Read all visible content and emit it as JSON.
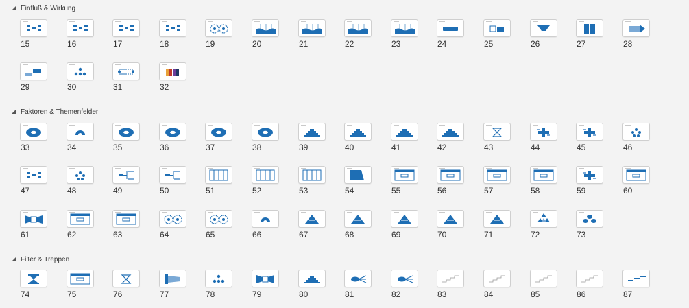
{
  "colors": {
    "accent": "#1e6eb4",
    "light": "#7aa9d6",
    "bg": "#f3f3f3"
  },
  "sections": [
    {
      "title": "Einfluß & Wirkung",
      "items": [
        {
          "n": "15",
          "t": "chart"
        },
        {
          "n": "16",
          "t": "chart"
        },
        {
          "n": "17",
          "t": "chart"
        },
        {
          "n": "18",
          "t": "chart"
        },
        {
          "n": "19",
          "t": "rings"
        },
        {
          "n": "20",
          "t": "wave"
        },
        {
          "n": "21",
          "t": "wave"
        },
        {
          "n": "22",
          "t": "wave"
        },
        {
          "n": "23",
          "t": "wave"
        },
        {
          "n": "24",
          "t": "bar"
        },
        {
          "n": "25",
          "t": "boxes"
        },
        {
          "n": "26",
          "t": "funnel"
        },
        {
          "n": "27",
          "t": "blocks"
        },
        {
          "n": "28",
          "t": "arrow"
        },
        {
          "n": "29",
          "t": "step"
        },
        {
          "n": "30",
          "t": "dots"
        },
        {
          "n": "31",
          "t": "cycle"
        },
        {
          "n": "32",
          "t": "color"
        }
      ]
    },
    {
      "title": "Faktoren & Themenfelder",
      "items": [
        {
          "n": "33",
          "t": "ellipse"
        },
        {
          "n": "34",
          "t": "semi"
        },
        {
          "n": "35",
          "t": "ellipse"
        },
        {
          "n": "36",
          "t": "ellipse"
        },
        {
          "n": "37",
          "t": "ellipse"
        },
        {
          "n": "38",
          "t": "ellipse"
        },
        {
          "n": "39",
          "t": "stack"
        },
        {
          "n": "40",
          "t": "stack"
        },
        {
          "n": "41",
          "t": "stack"
        },
        {
          "n": "42",
          "t": "stack"
        },
        {
          "n": "43",
          "t": "hourglass"
        },
        {
          "n": "44",
          "t": "cross"
        },
        {
          "n": "45",
          "t": "cross"
        },
        {
          "n": "46",
          "t": "ring5"
        },
        {
          "n": "47",
          "t": "chart"
        },
        {
          "n": "48",
          "t": "ring5"
        },
        {
          "n": "49",
          "t": "tree"
        },
        {
          "n": "50",
          "t": "tree"
        },
        {
          "n": "51",
          "t": "cols"
        },
        {
          "n": "52",
          "t": "cols"
        },
        {
          "n": "53",
          "t": "cols"
        },
        {
          "n": "54",
          "t": "solid"
        },
        {
          "n": "55",
          "t": "frame"
        },
        {
          "n": "56",
          "t": "frame"
        },
        {
          "n": "57",
          "t": "frame"
        },
        {
          "n": "58",
          "t": "frame"
        },
        {
          "n": "59",
          "t": "cross"
        },
        {
          "n": "60",
          "t": "frame"
        },
        {
          "n": "61",
          "t": "bow"
        },
        {
          "n": "62",
          "t": "frame"
        },
        {
          "n": "63",
          "t": "frame"
        },
        {
          "n": "64",
          "t": "rings"
        },
        {
          "n": "65",
          "t": "rings"
        },
        {
          "n": "66",
          "t": "semi"
        },
        {
          "n": "67",
          "t": "pyramid"
        },
        {
          "n": "68",
          "t": "pyramid"
        },
        {
          "n": "69",
          "t": "pyramid"
        },
        {
          "n": "70",
          "t": "pyramid"
        },
        {
          "n": "71",
          "t": "pyramid"
        },
        {
          "n": "72",
          "t": "tripyr"
        },
        {
          "n": "73",
          "t": "cloud"
        }
      ]
    },
    {
      "title": "Filter & Treppen",
      "items": [
        {
          "n": "74",
          "t": "hourglassblue"
        },
        {
          "n": "75",
          "t": "frame"
        },
        {
          "n": "76",
          "t": "hourglass"
        },
        {
          "n": "77",
          "t": "flag"
        },
        {
          "n": "78",
          "t": "dots"
        },
        {
          "n": "79",
          "t": "bow"
        },
        {
          "n": "80",
          "t": "stack"
        },
        {
          "n": "81",
          "t": "fan"
        },
        {
          "n": "82",
          "t": "fan"
        },
        {
          "n": "83",
          "t": "stairs"
        },
        {
          "n": "84",
          "t": "stairs"
        },
        {
          "n": "85",
          "t": "stairs"
        },
        {
          "n": "86",
          "t": "stairs"
        },
        {
          "n": "87",
          "t": "stairsblue"
        }
      ]
    }
  ]
}
